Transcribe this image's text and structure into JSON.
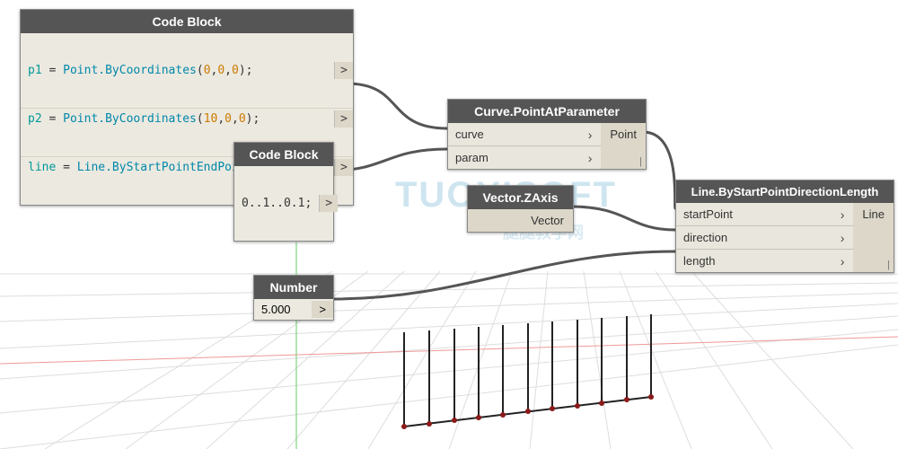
{
  "watermark": {
    "large": "TUOYISOFT",
    "small": "腿腿教学网"
  },
  "codeblock1": {
    "title": "Code Block",
    "lines": [
      {
        "var": "p1",
        "expr": "Point.ByCoordinates(0,0,0);"
      },
      {
        "var": "p2",
        "expr": "Point.ByCoordinates(10,0,0);"
      },
      {
        "var": "line",
        "expr": "Line.ByStartPointEndPoint(p1,p2);"
      }
    ]
  },
  "codeblock2": {
    "title": "Code Block",
    "code": "0..1..0.1;"
  },
  "number": {
    "title": "Number",
    "value": "5.000"
  },
  "curvePt": {
    "title": "Curve.PointAtParameter",
    "inputs": [
      "curve",
      "param"
    ],
    "output": "Point"
  },
  "zaxis": {
    "title": "Vector.ZAxis",
    "output": "Vector"
  },
  "lineNode": {
    "title": "Line.ByStartPointDirectionLength",
    "inputs": [
      "startPoint",
      "direction",
      "length"
    ],
    "output": "Line"
  }
}
